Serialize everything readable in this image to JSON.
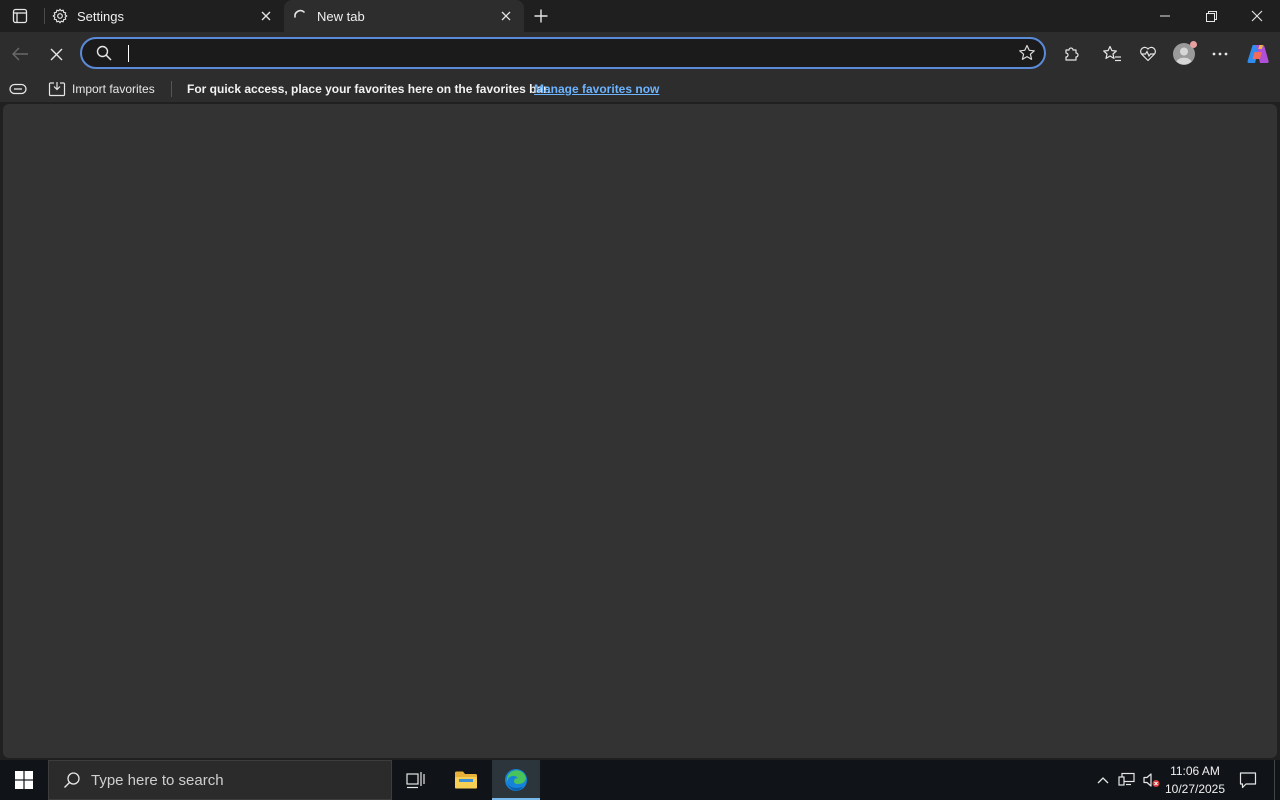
{
  "tabs": [
    {
      "title": "Settings",
      "icon": "gear-icon"
    },
    {
      "title": "New tab",
      "icon": "loading-spinner-icon"
    }
  ],
  "address_bar": {
    "value": "",
    "placeholder": ""
  },
  "favorites_bar": {
    "import_label": "Import favorites",
    "message": "For quick access, place your favorites here on the favorites bar.",
    "manage_link": "Manage favorites now"
  },
  "taskbar": {
    "search_placeholder": "Type here to search",
    "time": "11:06 AM",
    "date": "10/27/2025"
  },
  "colors": {
    "accent": "#5b8bd8",
    "link": "#6cb4ff",
    "content_bg": "#333333",
    "toolbar_bg": "#2d2d2d",
    "taskbar_bg": "#101418"
  }
}
